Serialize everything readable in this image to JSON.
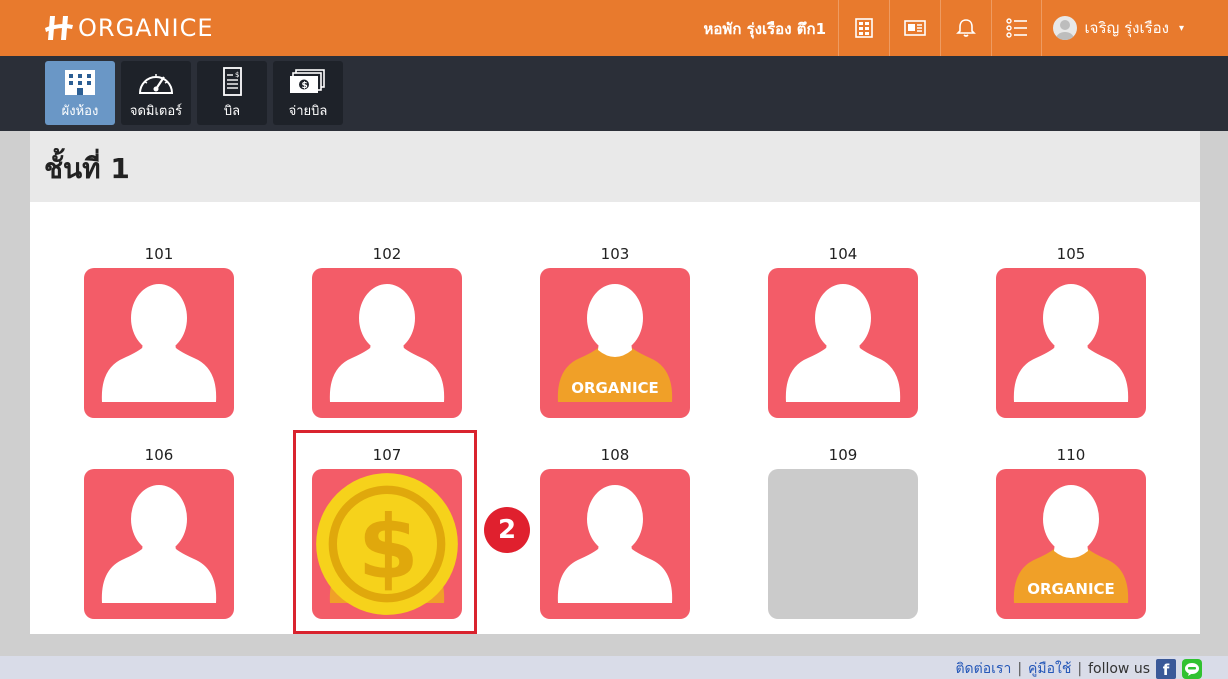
{
  "header": {
    "logo_text": "ORGANICE",
    "dorm_name": "หอพัก รุ่งเรือง ตึก1",
    "icons": [
      "grid-icon",
      "newspaper-icon",
      "bell-icon",
      "list-icon"
    ],
    "user_name": "เจริญ รุ่งเรือง",
    "caret": "▾"
  },
  "toolbar": {
    "items": [
      {
        "label": "ผังห้อง",
        "icon": "building-icon",
        "active": true
      },
      {
        "label": "จดมิเตอร์",
        "icon": "gauge-icon",
        "active": false
      },
      {
        "label": "บิล",
        "icon": "bill-icon",
        "active": false
      },
      {
        "label": "จ่ายบิล",
        "icon": "money-icon",
        "active": false
      }
    ]
  },
  "floor": {
    "title": "ชั้นที่ 1",
    "rooms": [
      {
        "number": "101",
        "status": "occupied",
        "shirt": false,
        "coin": false
      },
      {
        "number": "102",
        "status": "occupied",
        "shirt": false,
        "coin": false
      },
      {
        "number": "103",
        "status": "occupied",
        "shirt": true,
        "shirt_text": "ORGANICE",
        "coin": false
      },
      {
        "number": "104",
        "status": "occupied",
        "shirt": false,
        "coin": false
      },
      {
        "number": "105",
        "status": "occupied",
        "shirt": false,
        "coin": false
      },
      {
        "number": "106",
        "status": "occupied",
        "shirt": false,
        "coin": false
      },
      {
        "number": "107",
        "status": "occupied",
        "shirt": true,
        "shirt_text": "ORGANICE",
        "coin": true
      },
      {
        "number": "108",
        "status": "occupied",
        "shirt": false,
        "coin": false
      },
      {
        "number": "109",
        "status": "empty",
        "shirt": false,
        "coin": false
      },
      {
        "number": "110",
        "status": "occupied",
        "shirt": true,
        "shirt_text": "ORGANICE",
        "coin": false
      }
    ]
  },
  "annotation": {
    "step": "2"
  },
  "footer": {
    "contact": "ติดต่อเรา",
    "manual": "คู่มือใช้",
    "separator": "|",
    "follow": "follow us",
    "facebook_glyph": "f"
  },
  "colors": {
    "header_bg": "#e87a2d",
    "toolbar_bg": "#2b2f38",
    "room_occupied": "#f35c68",
    "room_empty": "#cbcbcb",
    "shirt": "#f0a028",
    "highlight": "#d9232e"
  }
}
